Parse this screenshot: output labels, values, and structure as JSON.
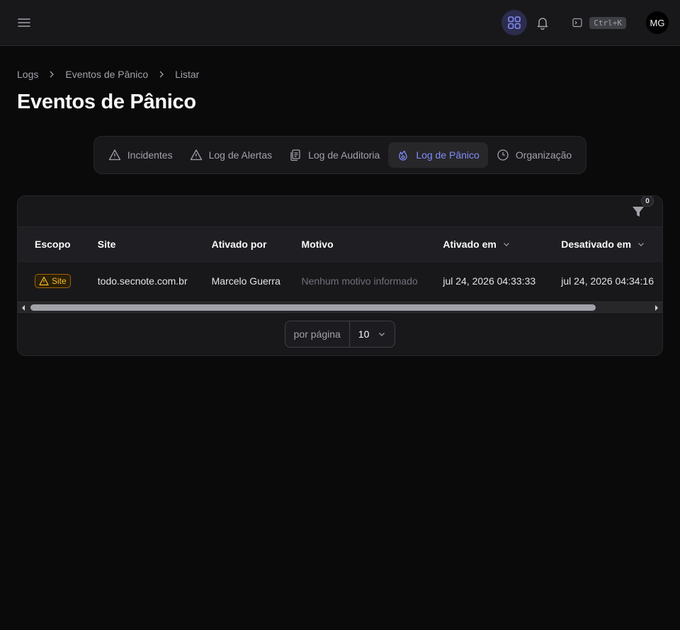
{
  "topbar": {
    "menu_icon": "hamburger-menu-icon",
    "apps_icon": "apps-grid-icon",
    "bell_icon": "bell-icon",
    "command_icon": "terminal-icon",
    "shortcut": "Ctrl+K",
    "avatar_initials": "MG"
  },
  "breadcrumb": [
    "Logs",
    "Eventos de Pânico",
    "Listar"
  ],
  "page_title": "Eventos de Pânico",
  "tabs": [
    {
      "label": "Incidentes",
      "icon": "warning-triangle-icon",
      "active": false
    },
    {
      "label": "Log de Alertas",
      "icon": "warning-triangle-icon",
      "active": false
    },
    {
      "label": "Log de Auditoria",
      "icon": "clipboard-document-icon",
      "active": false
    },
    {
      "label": "Log de Pânico",
      "icon": "fire-icon",
      "active": true
    },
    {
      "label": "Organização",
      "icon": "clock-icon",
      "active": false
    }
  ],
  "filter": {
    "badge_count": "0",
    "icon": "funnel-icon"
  },
  "table": {
    "columns": [
      "Escopo",
      "Site",
      "Ativado por",
      "Motivo",
      "Ativado em",
      "Desativado em"
    ],
    "rows": [
      {
        "scope": "Site",
        "site": "todo.secnote.com.br",
        "activated_by": "Marcelo Guerra",
        "reason": "Nenhum motivo informado",
        "activated_at": "jul 24, 2026 04:33:33",
        "deactivated_at": "jul 24, 2026 04:34:16"
      }
    ]
  },
  "pagination": {
    "per_page_label": "por página",
    "per_page_value": "10"
  },
  "colors": {
    "accent": "#818cf8",
    "warning": "#fbbf24",
    "background": "#0a0a0b",
    "surface": "#18181b"
  }
}
